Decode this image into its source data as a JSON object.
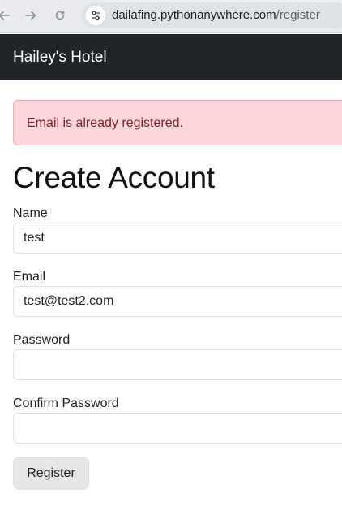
{
  "browser": {
    "url_host": "dailafing.pythonanywhere.com",
    "url_path": "/register"
  },
  "navbar": {
    "brand": "Hailey's Hotel"
  },
  "alert": {
    "message": "Email is already registered."
  },
  "page": {
    "title": "Create Account"
  },
  "form": {
    "name_label": "Name",
    "name_value": "test",
    "email_label": "Email",
    "email_value": "test@test2.com",
    "password_label": "Password",
    "password_value": "",
    "confirm_label": "Confirm Password",
    "confirm_value": "",
    "submit_label": "Register"
  },
  "colors": {
    "navbar_bg": "#212529",
    "alert_bg": "#f8d7da",
    "alert_text": "#842029"
  }
}
